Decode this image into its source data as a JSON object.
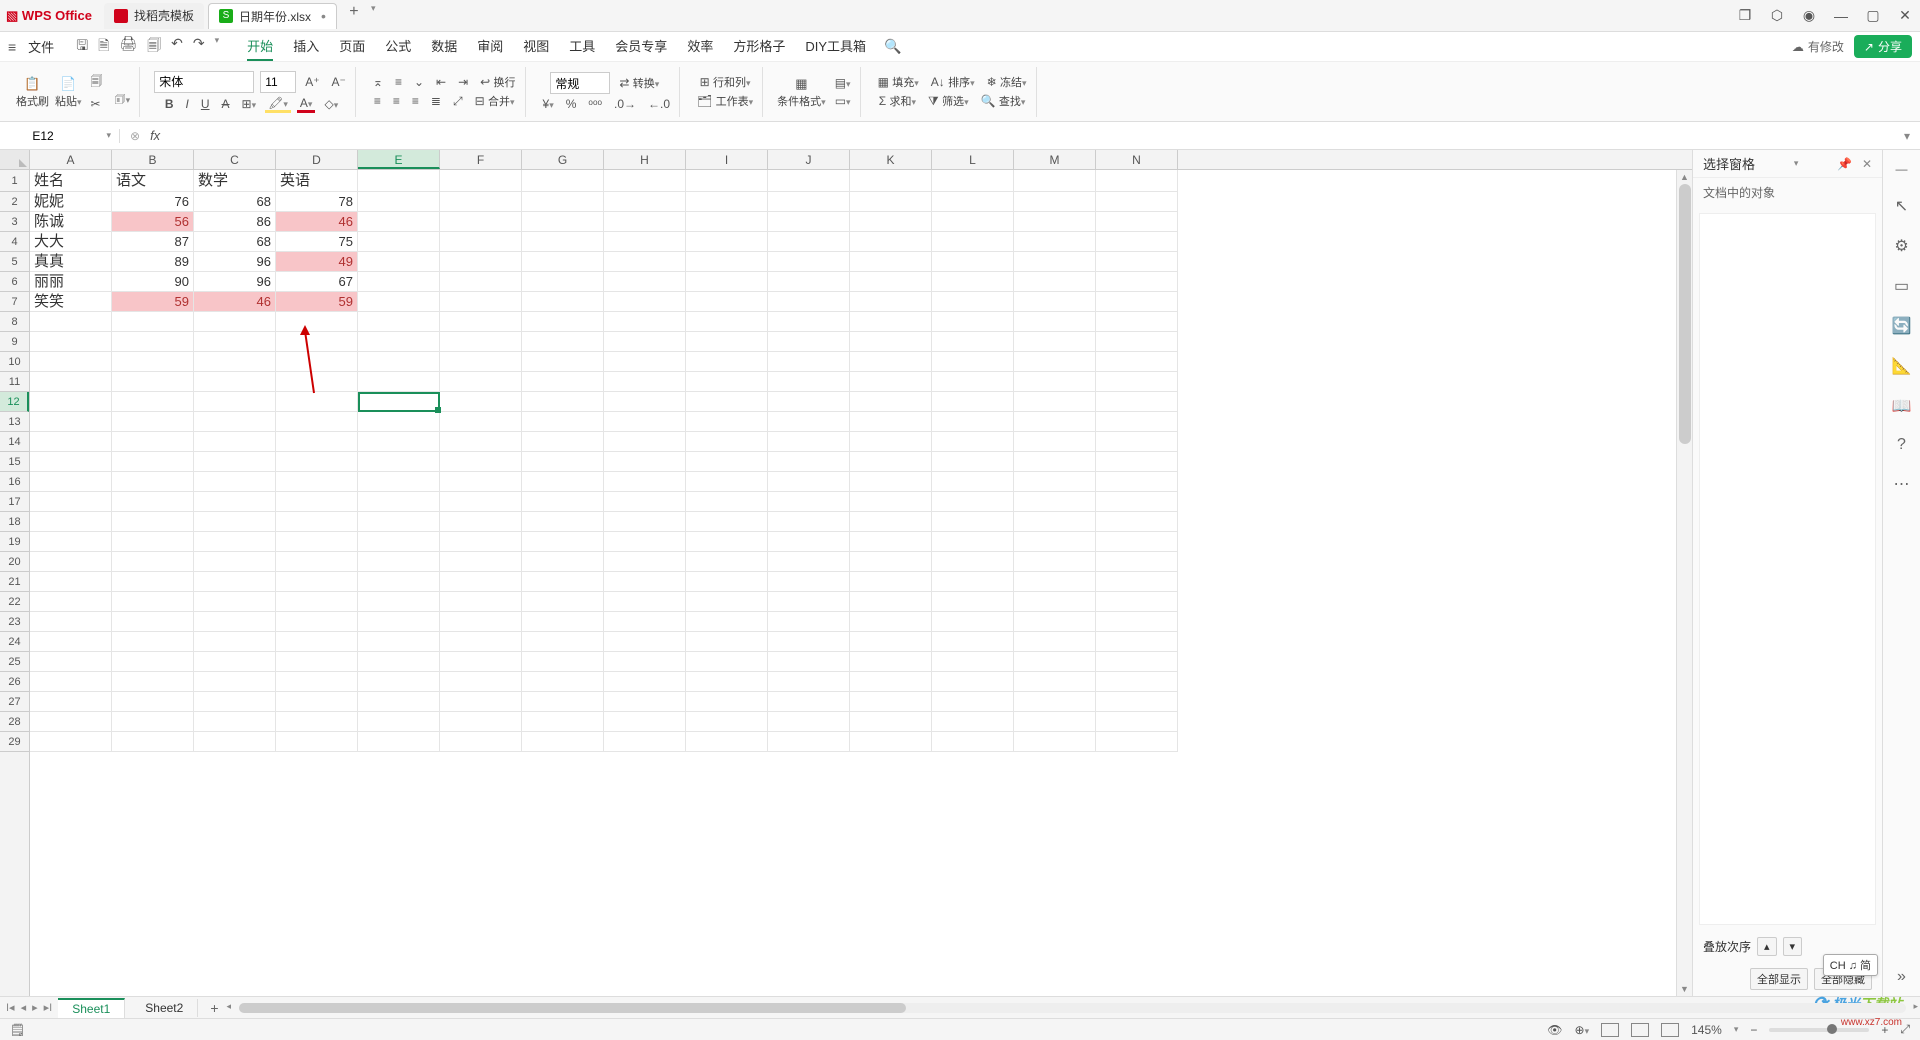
{
  "titlebar": {
    "logo_text": "WPS Office",
    "template_tab": "找稻壳模板",
    "file_tab": "日期年份.xlsx",
    "file_icon": "S"
  },
  "menubar": {
    "file": "文件",
    "tabs": [
      "开始",
      "插入",
      "页面",
      "公式",
      "数据",
      "审阅",
      "视图",
      "工具",
      "会员专享",
      "效率",
      "方形格子",
      "DIY工具箱"
    ],
    "cloud": "有修改",
    "share": "分享"
  },
  "ribbon": {
    "fmt_painter": "格式刷",
    "paste": "粘贴",
    "font_name": "宋体",
    "font_size": "11",
    "wrap": "换行",
    "merge": "合并",
    "numfmt": "常规",
    "transpose": "转换",
    "rowcol": "行和列",
    "worksheet": "工作表",
    "condfmt": "条件格式",
    "fill": "填充",
    "sort": "排序",
    "freeze": "冻结",
    "sum": "求和",
    "filter": "筛选",
    "find": "查找"
  },
  "formula": {
    "cell_ref": "E12",
    "fx": "fx"
  },
  "columns": [
    "A",
    "B",
    "C",
    "D",
    "E",
    "F",
    "G",
    "H",
    "I",
    "J",
    "K",
    "L",
    "M",
    "N"
  ],
  "selected_col_index": 4,
  "selected_row_index": 11,
  "chart_data": {
    "type": "table",
    "headers": [
      "姓名",
      "语文",
      "数学",
      "英语"
    ],
    "rows": [
      {
        "name": "妮妮",
        "yw": 76,
        "sx": 68,
        "yy": 78,
        "hl": []
      },
      {
        "name": "陈诚",
        "yw": 56,
        "sx": 86,
        "yy": 46,
        "hl": [
          "yw",
          "yy"
        ]
      },
      {
        "name": "大大",
        "yw": 87,
        "sx": 68,
        "yy": 75,
        "hl": []
      },
      {
        "name": "真真",
        "yw": 89,
        "sx": 96,
        "yy": 49,
        "hl": [
          "yy"
        ]
      },
      {
        "name": "丽丽",
        "yw": 90,
        "sx": 96,
        "yy": 67,
        "hl": []
      },
      {
        "name": "笑笑",
        "yw": 59,
        "sx": 46,
        "yy": 59,
        "hl": [
          "yw",
          "sx",
          "yy"
        ]
      }
    ]
  },
  "side": {
    "title": "选择窗格",
    "sub": "文档中的对象",
    "stack": "叠放次序",
    "show_all": "全部显示",
    "hide_all": "全部隐藏"
  },
  "sheets": {
    "active": "Sheet1",
    "other": "Sheet2"
  },
  "status": {
    "zoom": "145%",
    "ime": "CH ♫ 简"
  },
  "watermark": {
    "a": "极光",
    "b": "下载站",
    "url": "www.xz7.com"
  }
}
